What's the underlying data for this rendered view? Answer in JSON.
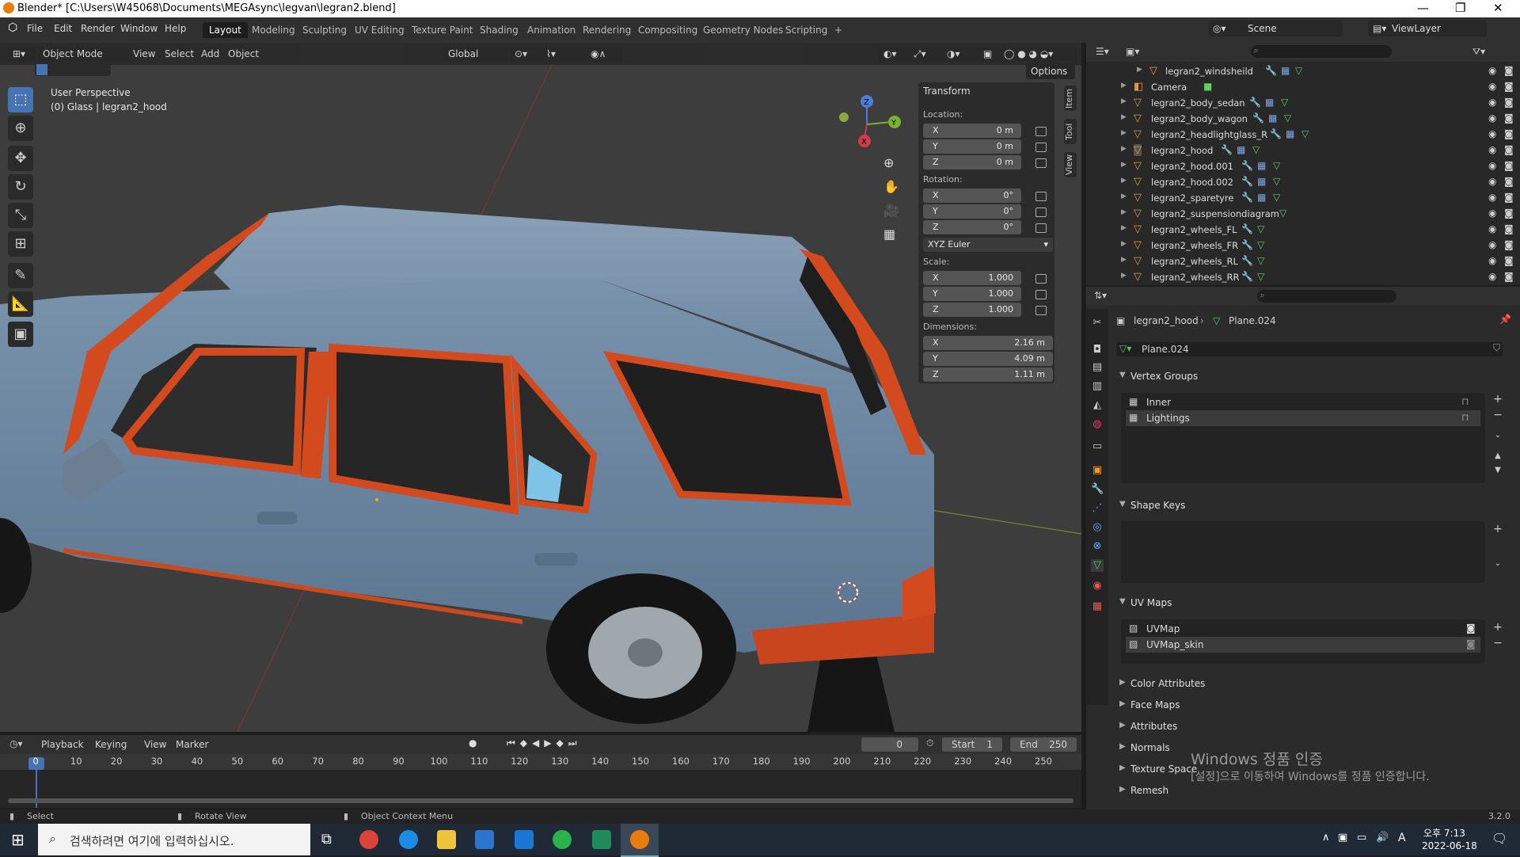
{
  "window": {
    "title": "Blender* [C:\\Users\\W45068\\Documents\\MEGAsync\\legvan\\legran2.blend]",
    "minimize_icon": "minimize-icon",
    "maximize_icon": "restore-icon",
    "close_icon": "close-icon"
  },
  "menu": {
    "items": [
      "File",
      "Edit",
      "Render",
      "Window",
      "Help"
    ],
    "workspaces": [
      "Layout",
      "Modeling",
      "Sculpting",
      "UV Editing",
      "Texture Paint",
      "Shading",
      "Animation",
      "Rendering",
      "Compositing",
      "Geometry Nodes",
      "Scripting"
    ],
    "active_workspace": "Layout",
    "add_workspace": "+",
    "scene_label": "Scene",
    "viewlayer_label": "ViewLayer"
  },
  "viewport": {
    "mode": "Object Mode",
    "menus": [
      "View",
      "Select",
      "Add",
      "Object"
    ],
    "transform_orientation": "Global",
    "options_label": "Options",
    "perspective_label": "User Perspective",
    "object_label": "(0) Glass | legran2_hood",
    "gizmo_axes": [
      "X",
      "Y",
      "Z"
    ]
  },
  "transform_panel": {
    "title": "Transform",
    "location_label": "Location:",
    "location": [
      {
        "axis": "X",
        "value": "0 m"
      },
      {
        "axis": "Y",
        "value": "0 m"
      },
      {
        "axis": "Z",
        "value": "0 m"
      }
    ],
    "rotation_label": "Rotation:",
    "rotation": [
      {
        "axis": "X",
        "value": "0°"
      },
      {
        "axis": "Y",
        "value": "0°"
      },
      {
        "axis": "Z",
        "value": "0°"
      }
    ],
    "rotation_mode": "XYZ Euler",
    "scale_label": "Scale:",
    "scale": [
      {
        "axis": "X",
        "value": "1.000"
      },
      {
        "axis": "Y",
        "value": "1.000"
      },
      {
        "axis": "Z",
        "value": "1.000"
      }
    ],
    "dimensions_label": "Dimensions:",
    "dimensions": [
      {
        "axis": "X",
        "value": "2.16 m"
      },
      {
        "axis": "Y",
        "value": "4.09 m"
      },
      {
        "axis": "Z",
        "value": "1.11 m"
      }
    ],
    "side_tabs": [
      "Item",
      "Tool",
      "View"
    ]
  },
  "outliner": {
    "rows": [
      {
        "name": "legran2_windsheild",
        "icon": "mesh-object-icon"
      },
      {
        "name": "Camera",
        "icon": "camera-object-icon"
      },
      {
        "name": "legran2_body_sedan",
        "icon": "mesh-object-icon"
      },
      {
        "name": "legran2_body_wagon",
        "icon": "mesh-object-icon"
      },
      {
        "name": "legran2_headlightglass_R",
        "icon": "mesh-object-icon"
      },
      {
        "name": "legran2_hood",
        "icon": "mesh-object-icon"
      },
      {
        "name": "legran2_hood.001",
        "icon": "mesh-object-icon"
      },
      {
        "name": "legran2_hood.002",
        "icon": "mesh-object-icon"
      },
      {
        "name": "legran2_sparetyre",
        "icon": "mesh-object-icon"
      },
      {
        "name": "legran2_suspensiondiagram",
        "icon": "mesh-object-icon"
      },
      {
        "name": "legran2_wheels_FL",
        "icon": "mesh-object-icon"
      },
      {
        "name": "legran2_wheels_FR",
        "icon": "mesh-object-icon"
      },
      {
        "name": "legran2_wheels_RL",
        "icon": "mesh-object-icon"
      },
      {
        "name": "legran2_wheels_RR",
        "icon": "mesh-object-icon"
      }
    ]
  },
  "properties": {
    "breadcrumb_object": "legran2_hood",
    "breadcrumb_data": "Plane.024",
    "mesh_name": "Plane.024",
    "vertex_groups_title": "Vertex Groups",
    "vertex_groups": [
      "Inner",
      "Lightings"
    ],
    "shape_keys_title": "Shape Keys",
    "uv_maps_title": "UV Maps",
    "uv_maps": [
      "UVMap",
      "UVMap_skin"
    ],
    "collapsed_sections": [
      "Color Attributes",
      "Face Maps",
      "Attributes",
      "Normals",
      "Texture Space",
      "Remesh"
    ]
  },
  "timeline": {
    "menus": [
      "Playback",
      "Keying",
      "View",
      "Marker"
    ],
    "current_frame": "0",
    "start_label": "Start",
    "start": "1",
    "end_label": "End",
    "end": "250",
    "frame_marks": [
      "0",
      "10",
      "20",
      "30",
      "40",
      "50",
      "60",
      "70",
      "80",
      "90",
      "100",
      "110",
      "120",
      "130",
      "140",
      "150",
      "160",
      "170",
      "180",
      "190",
      "200",
      "210",
      "220",
      "230",
      "240",
      "250"
    ]
  },
  "statusbar": {
    "select": "Select",
    "rotate": "Rotate View",
    "context": "Object Context Menu",
    "version": "3.2.0"
  },
  "watermark": {
    "line1": "Windows 정품 인증",
    "line2": "[설정]으로 이동하여 Windows를 정품 인증합니다."
  },
  "taskbar": {
    "search_placeholder": "검색하려면 여기에 입력하십시오.",
    "time": "오후 7:13",
    "date": "2022-06-18",
    "ime": "A"
  }
}
